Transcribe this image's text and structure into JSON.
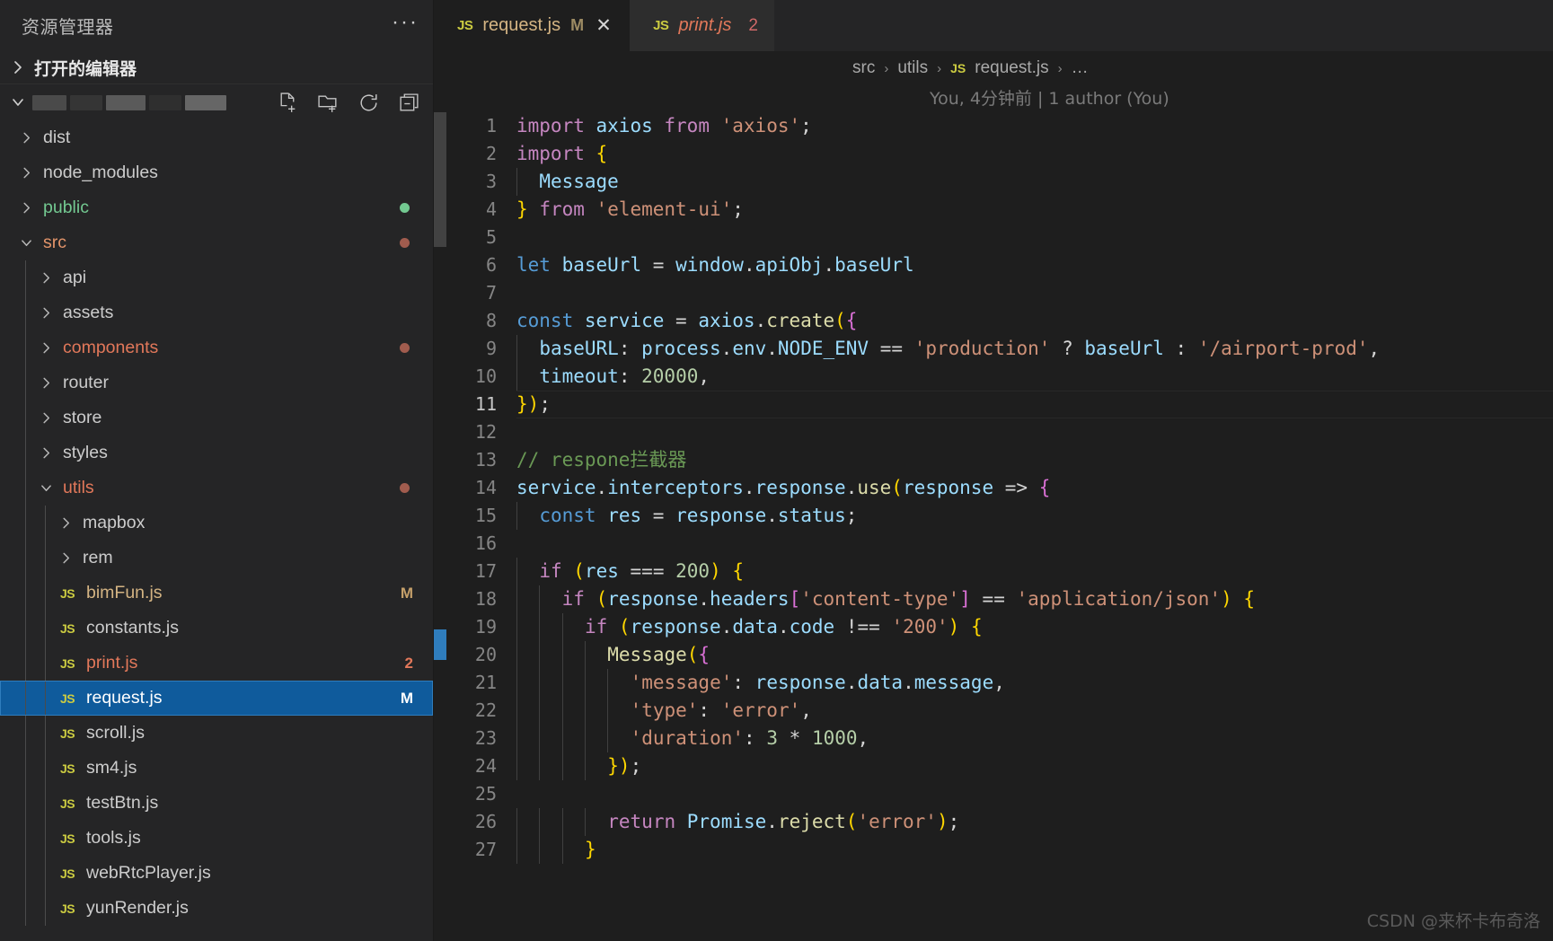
{
  "sidebar": {
    "title": "资源管理器",
    "more_label": "···",
    "open_editors_label": "打开的编辑器",
    "root_actions": [
      "new-file",
      "new-folder",
      "refresh",
      "collapse-all"
    ],
    "tree": [
      {
        "name": "dist",
        "type": "folder",
        "depth": 0,
        "expanded": false,
        "color": "#cccccc",
        "badge": "",
        "dot": ""
      },
      {
        "name": "node_modules",
        "type": "folder",
        "depth": 0,
        "expanded": false,
        "color": "#cccccc",
        "badge": "",
        "dot": ""
      },
      {
        "name": "public",
        "type": "folder",
        "depth": 0,
        "expanded": false,
        "color": "#73c991",
        "badge": "",
        "dot": "#73c991"
      },
      {
        "name": "src",
        "type": "folder",
        "depth": 0,
        "expanded": true,
        "color": "#e2946a",
        "badge": "",
        "dot": "#a15c4e"
      },
      {
        "name": "api",
        "type": "folder",
        "depth": 1,
        "expanded": false,
        "color": "#cccccc",
        "badge": "",
        "dot": ""
      },
      {
        "name": "assets",
        "type": "folder",
        "depth": 1,
        "expanded": false,
        "color": "#cccccc",
        "badge": "",
        "dot": ""
      },
      {
        "name": "components",
        "type": "folder",
        "depth": 1,
        "expanded": false,
        "color": "#e2785a",
        "badge": "",
        "dot": "#a15c4e"
      },
      {
        "name": "router",
        "type": "folder",
        "depth": 1,
        "expanded": false,
        "color": "#cccccc",
        "badge": "",
        "dot": ""
      },
      {
        "name": "store",
        "type": "folder",
        "depth": 1,
        "expanded": false,
        "color": "#cccccc",
        "badge": "",
        "dot": ""
      },
      {
        "name": "styles",
        "type": "folder",
        "depth": 1,
        "expanded": false,
        "color": "#cccccc",
        "badge": "",
        "dot": ""
      },
      {
        "name": "utils",
        "type": "folder",
        "depth": 1,
        "expanded": true,
        "color": "#e2785a",
        "badge": "",
        "dot": "#a15c4e"
      },
      {
        "name": "mapbox",
        "type": "folder",
        "depth": 2,
        "expanded": false,
        "color": "#cccccc",
        "badge": "",
        "dot": ""
      },
      {
        "name": "rem",
        "type": "folder",
        "depth": 2,
        "expanded": false,
        "color": "#cccccc",
        "badge": "",
        "dot": ""
      },
      {
        "name": "bimFun.js",
        "type": "file",
        "depth": 2,
        "expanded": false,
        "color": "#d4b483",
        "badge": "M",
        "badge_color": "#c5a06a",
        "dot": ""
      },
      {
        "name": "constants.js",
        "type": "file",
        "depth": 2,
        "expanded": false,
        "color": "#cccccc",
        "badge": "",
        "dot": ""
      },
      {
        "name": "print.js",
        "type": "file",
        "depth": 2,
        "expanded": false,
        "color": "#e2785a",
        "badge": "2",
        "badge_color": "#e2785a",
        "dot": ""
      },
      {
        "name": "request.js",
        "type": "file",
        "depth": 2,
        "expanded": false,
        "color": "#ffffff",
        "badge": "M",
        "badge_color": "#ffffff",
        "dot": "",
        "selected": true
      },
      {
        "name": "scroll.js",
        "type": "file",
        "depth": 2,
        "expanded": false,
        "color": "#cccccc",
        "badge": "",
        "dot": ""
      },
      {
        "name": "sm4.js",
        "type": "file",
        "depth": 2,
        "expanded": false,
        "color": "#cccccc",
        "badge": "",
        "dot": ""
      },
      {
        "name": "testBtn.js",
        "type": "file",
        "depth": 2,
        "expanded": false,
        "color": "#cccccc",
        "badge": "",
        "dot": ""
      },
      {
        "name": "tools.js",
        "type": "file",
        "depth": 2,
        "expanded": false,
        "color": "#cccccc",
        "badge": "",
        "dot": ""
      },
      {
        "name": "webRtcPlayer.js",
        "type": "file",
        "depth": 2,
        "expanded": false,
        "color": "#cccccc",
        "badge": "",
        "dot": ""
      },
      {
        "name": "yunRender.js",
        "type": "file",
        "depth": 2,
        "expanded": false,
        "color": "#cccccc",
        "badge": "",
        "dot": ""
      }
    ]
  },
  "tabs": [
    {
      "icon": "JS",
      "label": "request.js",
      "badge": "M",
      "close": "✕",
      "active": true,
      "italic": false
    },
    {
      "icon": "JS",
      "label": "print.js",
      "badge": "2",
      "close": "",
      "active": false,
      "italic": true
    }
  ],
  "breadcrumb": {
    "items": [
      "src",
      "utils",
      "request.js",
      "…"
    ],
    "file_icon": "JS",
    "separator": "›"
  },
  "blame": "You, 4分钟前 | 1 author (You)",
  "editor": {
    "current_line": 11,
    "lines": [
      {
        "n": 1,
        "text": "import axios from 'axios';"
      },
      {
        "n": 2,
        "text": "import {"
      },
      {
        "n": 3,
        "text": "  Message"
      },
      {
        "n": 4,
        "text": "} from 'element-ui';"
      },
      {
        "n": 5,
        "text": ""
      },
      {
        "n": 6,
        "text": "let baseUrl = window.apiObj.baseUrl"
      },
      {
        "n": 7,
        "text": ""
      },
      {
        "n": 8,
        "text": "const service = axios.create({"
      },
      {
        "n": 9,
        "text": "  baseURL: process.env.NODE_ENV == 'production' ? baseUrl : '/airport-prod',"
      },
      {
        "n": 10,
        "text": "  timeout: 20000,"
      },
      {
        "n": 11,
        "text": "});"
      },
      {
        "n": 12,
        "text": ""
      },
      {
        "n": 13,
        "text": "// respone拦截器"
      },
      {
        "n": 14,
        "text": "service.interceptors.response.use(response => {"
      },
      {
        "n": 15,
        "text": "  const res = response.status;"
      },
      {
        "n": 16,
        "text": ""
      },
      {
        "n": 17,
        "text": "  if (res === 200) {"
      },
      {
        "n": 18,
        "text": "    if (response.headers['content-type'] == 'application/json') {"
      },
      {
        "n": 19,
        "text": "      if (response.data.code !== '200') {"
      },
      {
        "n": 20,
        "text": "        Message({"
      },
      {
        "n": 21,
        "text": "          'message': response.data.message,"
      },
      {
        "n": 22,
        "text": "          'type': 'error',"
      },
      {
        "n": 23,
        "text": "          'duration': 3 * 1000,"
      },
      {
        "n": 24,
        "text": "        });"
      },
      {
        "n": 25,
        "text": ""
      },
      {
        "n": 26,
        "text": "        return Promise.reject('error');"
      },
      {
        "n": 27,
        "text": "      }"
      }
    ]
  },
  "watermark": "CSDN @来杯卡布奇洛",
  "colors": {
    "sidebar_bg": "#252526",
    "editor_bg": "#1e1e1e",
    "selection_blue": "#0f5b9c",
    "js_yellow": "#cbcb41",
    "modified_tan": "#c5a06a",
    "error_red": "#e2785a",
    "untracked_green": "#73c991",
    "comment_green": "#6a9955"
  }
}
